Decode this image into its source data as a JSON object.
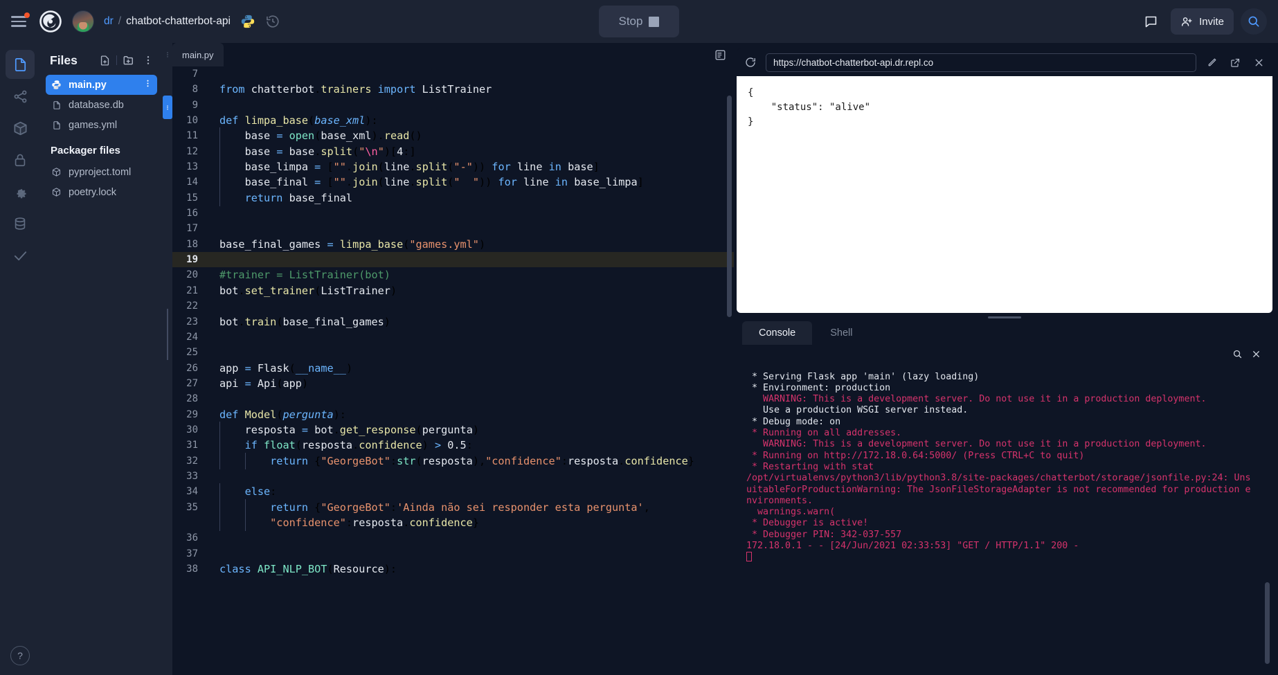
{
  "header": {
    "menu_icon": "hamburger-menu-icon",
    "logo_icon": "replit-logo-icon",
    "avatar_icon": "user-avatar",
    "breadcrumb": {
      "owner": "dr",
      "separator": "/",
      "repo": "chatbot-chatterbot-api"
    },
    "language_icon": "python-logo-icon",
    "history_icon": "history-revert-icon",
    "run_button": {
      "label": "Stop",
      "icon": "stop-square-icon"
    },
    "chat_icon": "chat-bubble-icon",
    "invite": {
      "label": "Invite",
      "icon": "add-person-icon"
    },
    "search_icon": "search-icon"
  },
  "rail": {
    "items": [
      {
        "name": "files",
        "icon": "file-icon",
        "active": true
      },
      {
        "name": "version-control",
        "icon": "git-branch-icon",
        "active": false
      },
      {
        "name": "packages",
        "icon": "package-box-icon",
        "active": false
      },
      {
        "name": "secrets",
        "icon": "lock-icon",
        "active": false
      },
      {
        "name": "settings",
        "icon": "gear-icon",
        "active": false
      },
      {
        "name": "database",
        "icon": "database-icon",
        "active": false
      },
      {
        "name": "checks",
        "icon": "checkmark-icon",
        "active": false
      }
    ],
    "help": {
      "label": "?",
      "icon": "help-icon"
    }
  },
  "files_pane": {
    "title": "Files",
    "actions": [
      {
        "name": "new-file",
        "icon": "file-plus-icon"
      },
      {
        "name": "new-folder",
        "icon": "folder-plus-icon"
      },
      {
        "name": "more",
        "icon": "kebab-menu-icon"
      }
    ],
    "files": [
      {
        "name": "main.py",
        "icon": "python-file-icon",
        "selected": true
      },
      {
        "name": "database.db",
        "icon": "file-icon",
        "selected": false
      },
      {
        "name": "games.yml",
        "icon": "file-icon",
        "selected": false
      }
    ],
    "packager_title": "Packager files",
    "packager_files": [
      {
        "name": "pyproject.toml",
        "icon": "package-icon"
      },
      {
        "name": "poetry.lock",
        "icon": "package-icon"
      }
    ]
  },
  "editor": {
    "tab_label": "main.py",
    "pane_menu_icon": "pane-layout-icon",
    "first_line_number": 7,
    "active_line": 19,
    "lines": [
      {
        "n": 7,
        "html": ""
      },
      {
        "n": 8,
        "html": "<span class=\"k\">from</span> <span class=\"var\">chatterbot</span>.<span class=\"fn\">trainers</span> <span class=\"k\">import</span> <span class=\"var\">ListTrainer</span>"
      },
      {
        "n": 9,
        "html": ""
      },
      {
        "n": 10,
        "html": "<span class=\"k\">def</span> <span class=\"fn\">limpa_base</span>(<span class=\"pv\">base_xml</span>):"
      },
      {
        "n": 11,
        "html": "<span class=\"indent\">    </span><span class=\"var\">base</span> <span class=\"op\">=</span> <span class=\"cls\">open</span>(<span class=\"var\">base_xml</span>).<span class=\"fn\">read</span>()"
      },
      {
        "n": 12,
        "html": "<span class=\"indent\">    </span><span class=\"var\">base</span> <span class=\"op\">=</span> <span class=\"var\">base</span>.<span class=\"fn\">split</span>(<span class=\"st\">\"</span><span class=\"esc\">\\n</span><span class=\"st\">\"</span>)[<span class=\"num\">4</span>:]"
      },
      {
        "n": 13,
        "html": "<span class=\"indent\">    </span><span class=\"var\">base_limpa</span> <span class=\"op\">=</span> [<span class=\"st\">\"\"</span>.<span class=\"fn\">join</span>(<span class=\"var\">line</span>.<span class=\"fn\">split</span>(<span class=\"st\">\"-\"</span>)) <span class=\"k\">for</span> <span class=\"var\">line</span> <span class=\"k\">in</span> <span class=\"var\">base</span>]"
      },
      {
        "n": 14,
        "html": "<span class=\"indent\">    </span><span class=\"var\">base_final</span> <span class=\"op\">=</span> [<span class=\"st\">\"\"</span>.<span class=\"fn\">join</span>(<span class=\"var\">line</span>.<span class=\"fn\">split</span>(<span class=\"st\">\"  \"</span>)) <span class=\"k\">for</span> <span class=\"var\">line</span> <span class=\"k\">in</span> <span class=\"var\">base_limpa</span>]"
      },
      {
        "n": 15,
        "html": "<span class=\"indent\">    </span><span class=\"k\">return</span> <span class=\"var\">base_final</span>"
      },
      {
        "n": 16,
        "html": ""
      },
      {
        "n": 17,
        "html": ""
      },
      {
        "n": 18,
        "html": "<span class=\"var\">base_final_games</span> <span class=\"op\">=</span> <span class=\"fn\">limpa_base</span>(<span class=\"st\">\"games.yml\"</span>)"
      },
      {
        "n": 19,
        "html": ""
      },
      {
        "n": 20,
        "html": "<span class=\"cm\">#trainer = ListTrainer(bot)</span>"
      },
      {
        "n": 21,
        "html": "<span class=\"var\">bot</span>.<span class=\"fn\">set_trainer</span>(<span class=\"var\">ListTrainer</span>)"
      },
      {
        "n": 22,
        "html": ""
      },
      {
        "n": 23,
        "html": "<span class=\"var\">bot</span>.<span class=\"fn\">train</span>(<span class=\"var\">base_final_games</span>)"
      },
      {
        "n": 24,
        "html": ""
      },
      {
        "n": 25,
        "html": ""
      },
      {
        "n": 26,
        "html": "<span class=\"var\">app</span> <span class=\"op\">=</span> <span class=\"var\">Flask</span>(<span class=\"dunder\">__name__</span>)"
      },
      {
        "n": 27,
        "html": "<span class=\"var\">api</span> <span class=\"op\">=</span> <span class=\"var\">Api</span>(<span class=\"var\">app</span>)"
      },
      {
        "n": 28,
        "html": ""
      },
      {
        "n": 29,
        "html": "<span class=\"k\">def</span> <span class=\"fn\">Model</span>(<span class=\"pv\">pergunta</span>):"
      },
      {
        "n": 30,
        "html": "<span class=\"indent\">    </span><span class=\"var\">resposta</span> <span class=\"op\">=</span> <span class=\"var\">bot</span>.<span class=\"fn\">get_response</span>(<span class=\"var\">pergunta</span>)"
      },
      {
        "n": 31,
        "html": "<span class=\"indent\">    </span><span class=\"k\">if</span> <span class=\"cls\">float</span>(<span class=\"var\">resposta</span>.<span class=\"fn\">confidence</span>) <span class=\"op\">&gt;</span> <span class=\"num\">0.5</span>:"
      },
      {
        "n": 32,
        "html": "<span class=\"indent\">    </span><span class=\"indent\">    </span><span class=\"k\">return</span> {<span class=\"st\">\"GeorgeBot\"</span>:<span class=\"cls\">str</span>(<span class=\"var\">resposta</span>),<span class=\"st\">\"confidence\"</span>:<span class=\"var\">resposta</span>.<span class=\"fn\">confidence</span>}"
      },
      {
        "n": 33,
        "html": ""
      },
      {
        "n": 34,
        "html": "<span class=\"indent\">    </span><span class=\"k\">else</span>:"
      },
      {
        "n": 35,
        "html": "<span class=\"indent\">    </span><span class=\"indent\">    </span><span class=\"k\">return</span> {<span class=\"st\">\"GeorgeBot\"</span>:<span class=\"st\">'Ainda não sei responder esta pergunta'</span>,"
      },
      {
        "n": "",
        "html": "<span class=\"indent\">    </span><span class=\"indent\">    </span><span class=\"st\">\"confidence\"</span>:<span class=\"var\">resposta</span>.<span class=\"fn\">confidence</span>}"
      },
      {
        "n": 36,
        "html": ""
      },
      {
        "n": 37,
        "html": ""
      },
      {
        "n": 38,
        "html": "<span class=\"k\">class</span> <span class=\"cls\">API_NLP_BOT</span>(<span class=\"var\">Resource</span>):"
      }
    ]
  },
  "webview": {
    "refresh_icon": "refresh-icon",
    "url": "https://chatbot-chatterbot-api.dr.repl.co",
    "edit_icon": "pencil-icon",
    "open_external_icon": "external-link-icon",
    "close_icon": "close-icon",
    "content": "{\n    \"status\": \"alive\"\n}"
  },
  "console": {
    "tabs": [
      {
        "label": "Console",
        "active": true
      },
      {
        "label": "Shell",
        "active": false
      }
    ],
    "search_icon": "search-icon",
    "clear_icon": "close-icon",
    "output": [
      {
        "text": " * Serving Flask app 'main' (lazy loading)",
        "color": "white"
      },
      {
        "text": " * Environment: production",
        "color": "white"
      },
      {
        "text": "   WARNING: This is a development server. Do not use it in a production deployment.",
        "color": "red"
      },
      {
        "text": "   Use a production WSGI server instead.",
        "color": "white"
      },
      {
        "text": " * Debug mode: on",
        "color": "white"
      },
      {
        "text": " * Running on all addresses.",
        "color": "red"
      },
      {
        "text": "   WARNING: This is a development server. Do not use it in a production deployment.",
        "color": "red"
      },
      {
        "text": " * Running on http://172.18.0.64:5000/ (Press CTRL+C to quit)",
        "color": "red"
      },
      {
        "text": " * Restarting with stat",
        "color": "red"
      },
      {
        "text": "/opt/virtualenvs/python3/lib/python3.8/site-packages/chatterbot/storage/jsonfile.py:24: UnsuitableForProductionWarning: The JsonFileStorageAdapter is not recommended for production environments.",
        "color": "red"
      },
      {
        "text": "  warnings.warn(",
        "color": "red"
      },
      {
        "text": " * Debugger is active!",
        "color": "red"
      },
      {
        "text": " * Debugger PIN: 342-037-557",
        "color": "red"
      },
      {
        "text": "172.18.0.1 - - [24/Jun/2021 02:33:53] \"GET / HTTP/1.1\" 200 -",
        "color": "red"
      }
    ]
  },
  "colors": {
    "accent": "#2f80ed",
    "background": "#0e1525",
    "panel": "#1c2333",
    "notification_dot": "#f5552a",
    "console_error": "#d6336c"
  }
}
